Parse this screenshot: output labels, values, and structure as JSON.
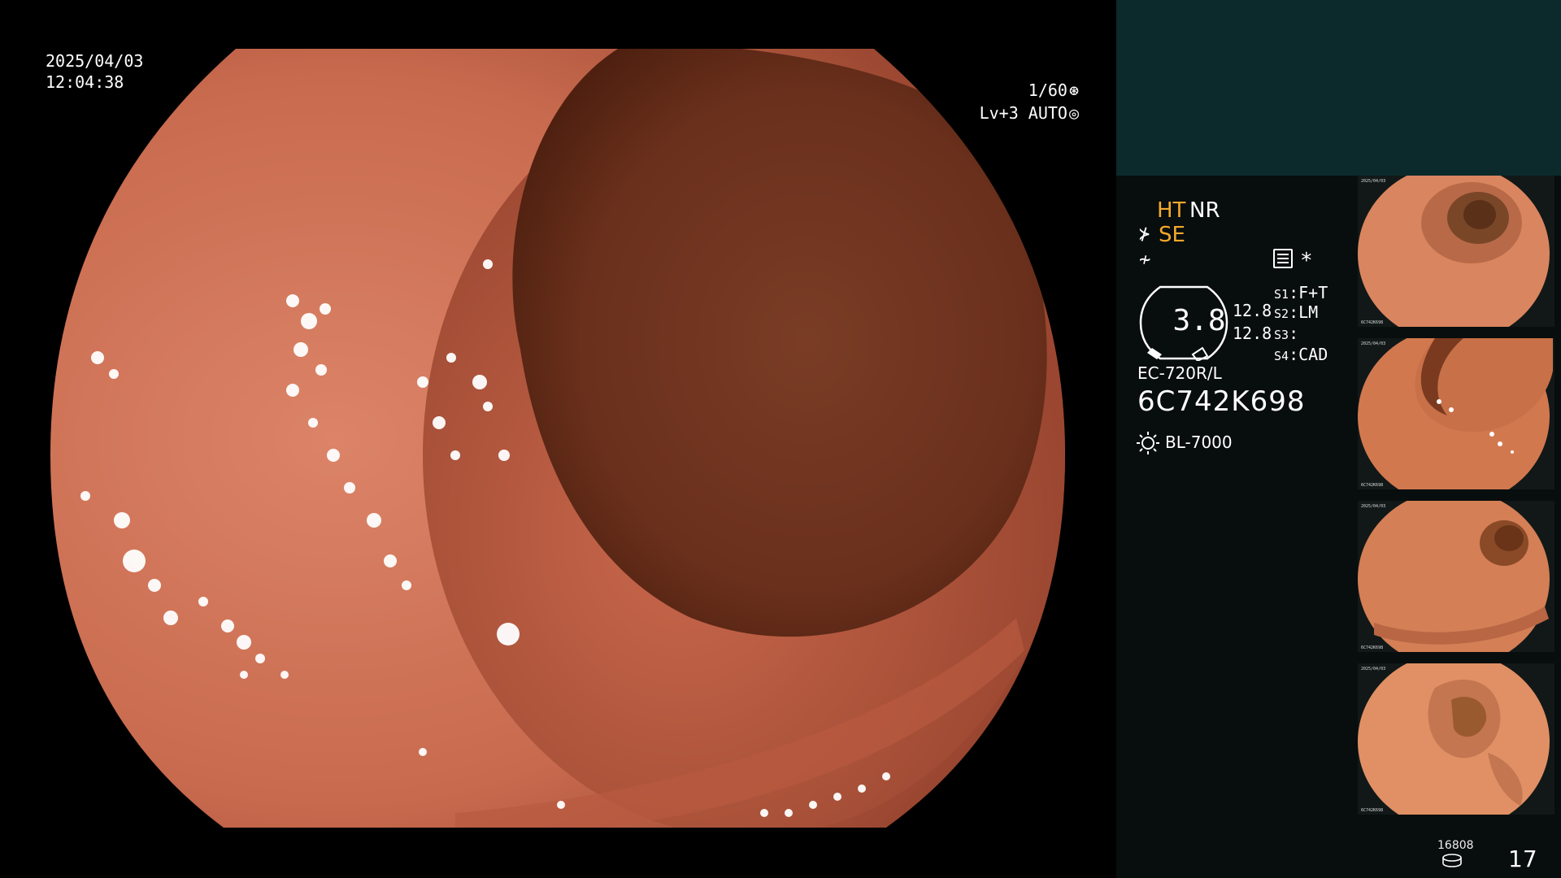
{
  "overlay": {
    "date": "2025/04/03",
    "time": "12:04:38",
    "shutter": "1/60",
    "shutter_icon": "aperture-icon",
    "exposure": "Lv+3 AUTO",
    "exposure_icon": "auto-exposure-icon"
  },
  "panel": {
    "ht": "HT",
    "nr": "NR",
    "se": "SE",
    "se_icon": "structure-enhance-icon",
    "f_icon": "freeze-icon",
    "settings_icon": "settings-panel-icon",
    "star": "*",
    "gauge_value": "3.8",
    "gauge_fill_fraction": 0.25,
    "g1": "12.8",
    "g2": "12.8",
    "slots": [
      {
        "key": "S1",
        "value": "F+T"
      },
      {
        "key": "S2",
        "value": "LM"
      },
      {
        "key": "S3",
        "value": ""
      },
      {
        "key": "S4",
        "value": "CAD"
      }
    ],
    "scope_model": "EC-720R/L",
    "serial": "6C742K698",
    "light_icon": "light-source-icon",
    "light_source": "BL-7000",
    "storage_count": "16808",
    "storage_icon": "storage-disk-icon",
    "frame_count": "17"
  },
  "thumbnails": [
    {
      "label": "captured-frame-1",
      "date": "2025/04/03",
      "id": "6C742K698"
    },
    {
      "label": "captured-frame-2",
      "date": "2025/04/03",
      "id": "6C742K698"
    },
    {
      "label": "captured-frame-3",
      "date": "2025/04/03",
      "id": "6C742K698"
    },
    {
      "label": "captured-frame-4",
      "date": "2025/04/03",
      "id": "6C742K698"
    }
  ],
  "colors": {
    "accent_orange": "#f4a92b",
    "panel_teal": "#0c2a2b",
    "panel_dark": "#080d0d",
    "tissue": "#c8654a",
    "lumen": "#6e3320"
  }
}
